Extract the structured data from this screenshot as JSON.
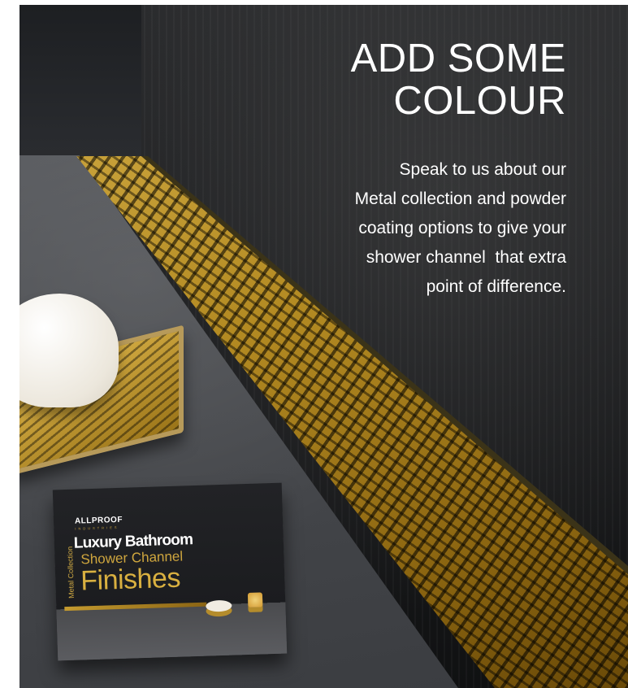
{
  "headline": {
    "line1": "ADD SOME",
    "line2": "COLOUR"
  },
  "body": {
    "lines": [
      "Speak to us about our",
      "Metal collection and powder",
      "coating options to give your",
      "shower channel  that extra",
      "point of difference."
    ]
  },
  "brochure": {
    "brand": "ALLPROOF",
    "tagline": "INDUSTRIES",
    "side_label": "Metal Collection",
    "line1": "Luxury Bathroom",
    "line2": "Shower Channel",
    "line3": "Finishes"
  },
  "colors": {
    "accent_gold": "#d9b040",
    "wall_dark": "#1c1d1f",
    "floor_grey": "#4a4c50",
    "text_white": "#ffffff"
  }
}
